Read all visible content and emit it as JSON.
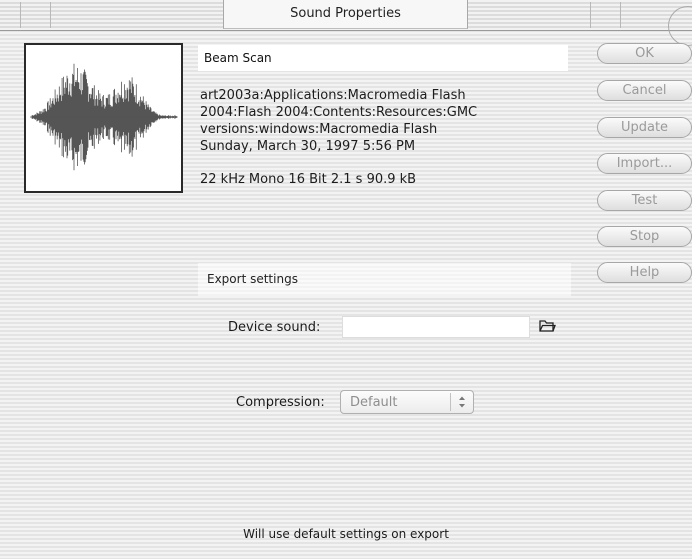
{
  "window": {
    "title": "Sound Properties"
  },
  "sound": {
    "name": "Beam Scan",
    "path_lines": [
      "art2003a:Applications:Macromedia Flash",
      "2004:Flash 2004:Contents:Resources:GMC",
      "versions:windows:Macromedia Flash",
      "Sunday, March 30, 1997  5:56 PM"
    ],
    "format": "22 kHz Mono 16 Bit 2.1 s 90.9 kB"
  },
  "buttons": {
    "ok": "OK",
    "cancel": "Cancel",
    "update": "Update",
    "import": "Import...",
    "test": "Test",
    "stop": "Stop",
    "help": "Help"
  },
  "export": {
    "section_label": "Export settings",
    "device_sound_label": "Device sound:",
    "device_sound_value": "",
    "compression_label": "Compression:",
    "compression_value": "Default",
    "footer_note": "Will use default settings on export"
  },
  "icons": {
    "waveform": "waveform-icon",
    "folder": "folder-icon",
    "select_arrows": "up-down-arrows-icon"
  },
  "colors": {
    "disabled_text": "#9a9a9a",
    "waveform": "#555555"
  }
}
